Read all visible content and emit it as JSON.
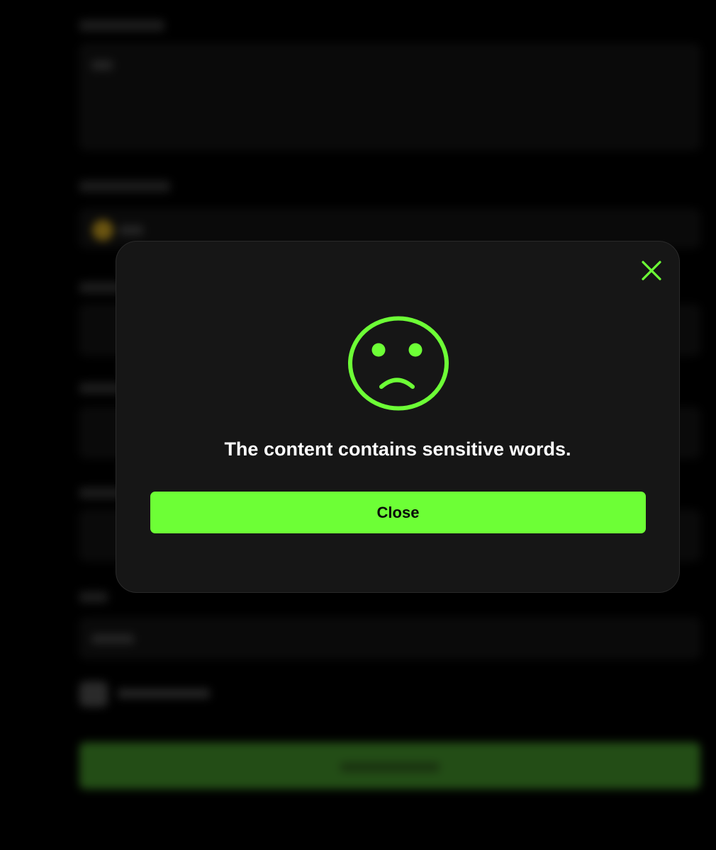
{
  "modal": {
    "message": "The content contains sensitive words.",
    "close_button_label": "Close",
    "close_icon": "close-icon",
    "status_icon": "sad-face-icon"
  },
  "colors": {
    "accent": "#6dff36",
    "modal_background": "#161616",
    "page_background": "#000000",
    "text": "#ffffff"
  }
}
